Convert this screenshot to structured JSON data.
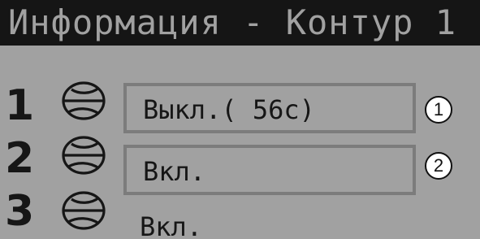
{
  "title": "Информация - Контур 1",
  "circuits": [
    {
      "number": "1",
      "fan_icon": "fan-icon",
      "status": "Выкл.( 56c)",
      "marker": "1"
    },
    {
      "number": "2",
      "fan_icon": "fan-icon",
      "status": "Вкл.",
      "marker": "2"
    },
    {
      "number": "3",
      "fan_icon": "fan-icon",
      "status": "Вкл."
    }
  ],
  "colors": {
    "background": "#a1a1a1",
    "title_bar": "#151515",
    "text": "#161616",
    "box_border": "#7c7c7c",
    "marker_fill": "#ffffff"
  }
}
